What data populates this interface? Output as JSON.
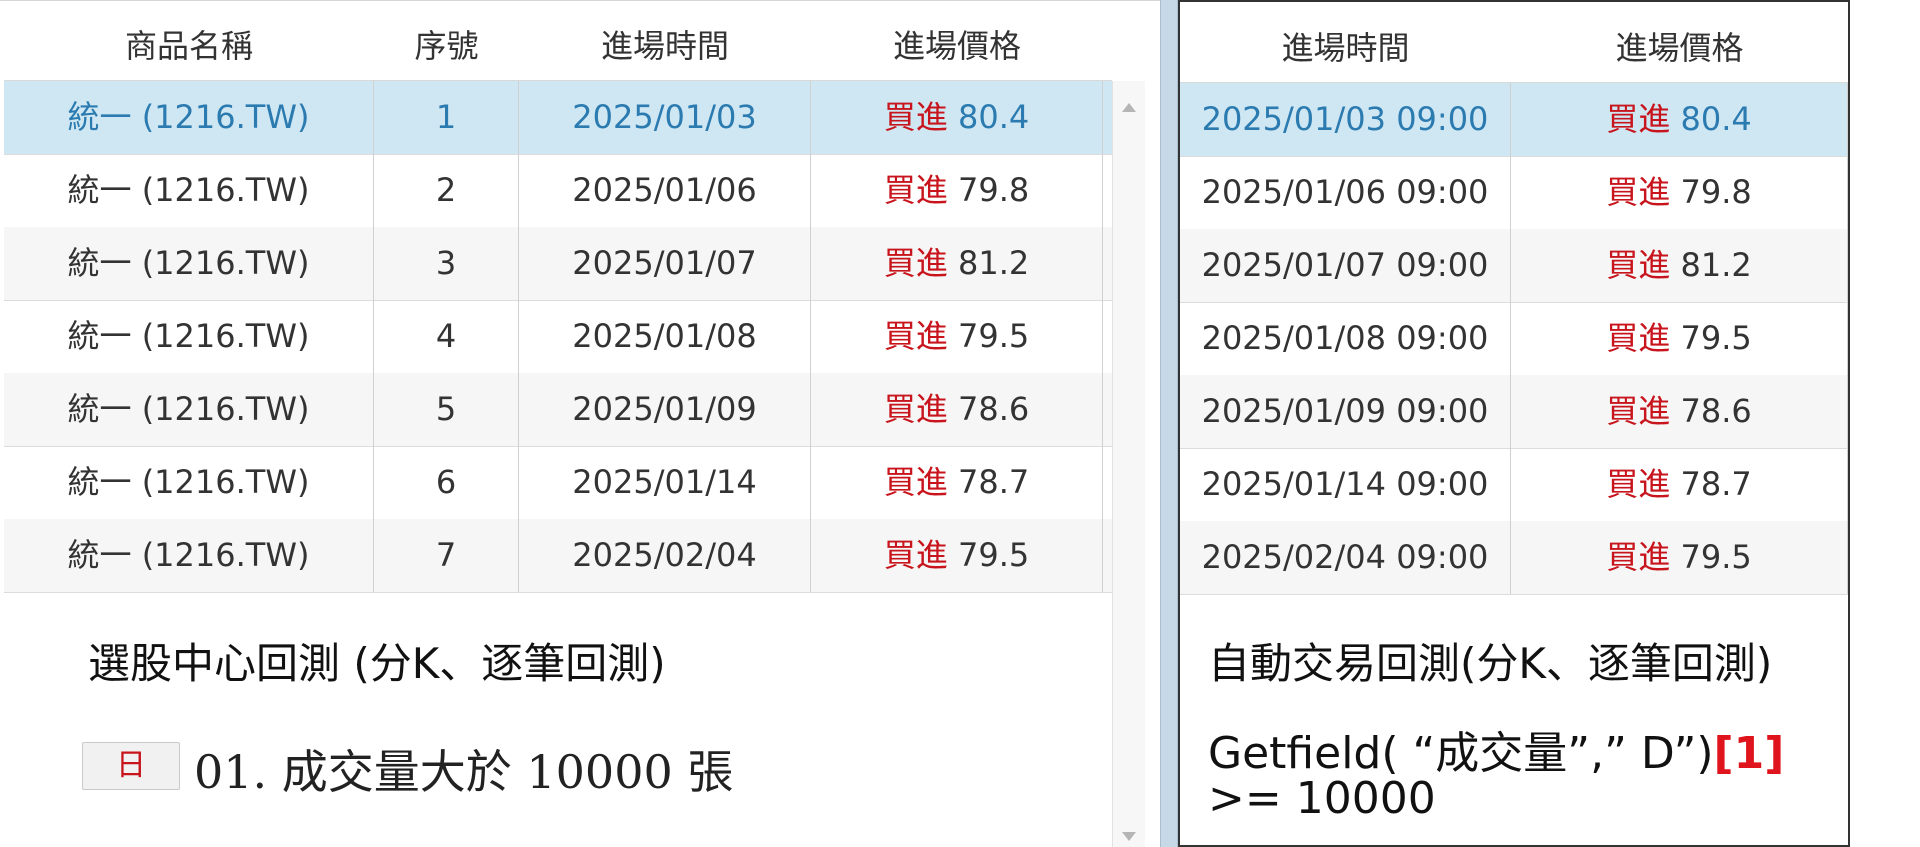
{
  "left_table": {
    "headers": [
      "商品名稱",
      "序號",
      "進場時間",
      "進場價格"
    ],
    "buy_label": "買進",
    "rows": [
      {
        "product": "統一 (1216.TW)",
        "seq": "1",
        "date": "2025/01/03",
        "price": "80.4"
      },
      {
        "product": "統一 (1216.TW)",
        "seq": "2",
        "date": "2025/01/06",
        "price": "79.8"
      },
      {
        "product": "統一 (1216.TW)",
        "seq": "3",
        "date": "2025/01/07",
        "price": "81.2"
      },
      {
        "product": "統一 (1216.TW)",
        "seq": "4",
        "date": "2025/01/08",
        "price": "79.5"
      },
      {
        "product": "統一 (1216.TW)",
        "seq": "5",
        "date": "2025/01/09",
        "price": "78.6"
      },
      {
        "product": "統一 (1216.TW)",
        "seq": "6",
        "date": "2025/01/14",
        "price": "78.7"
      },
      {
        "product": "統一 (1216.TW)",
        "seq": "7",
        "date": "2025/02/04",
        "price": "79.5"
      }
    ],
    "selected_row": 0
  },
  "left_caption": "選股中心回測 (分K、逐筆回測)",
  "condition": {
    "period_badge": "日",
    "text": "01. 成交量大於 10000 張"
  },
  "right_table": {
    "headers": [
      "進場時間",
      "進場價格"
    ],
    "buy_label": "買進",
    "rows": [
      {
        "time": "2025/01/03 09:00",
        "price": "80.4"
      },
      {
        "time": "2025/01/06 09:00",
        "price": "79.8"
      },
      {
        "time": "2025/01/07 09:00",
        "price": "81.2"
      },
      {
        "time": "2025/01/08 09:00",
        "price": "79.5"
      },
      {
        "time": "2025/01/09 09:00",
        "price": "78.6"
      },
      {
        "time": "2025/01/14 09:00",
        "price": "78.7"
      },
      {
        "time": "2025/02/04 09:00",
        "price": "79.5"
      }
    ],
    "selected_row": 0
  },
  "right_caption": "自動交易回測(分K、逐筆回測)",
  "formula": {
    "line1": "Getfield( “成交量”,” D”)",
    "ref": "[1]",
    "line2": ">= 10000"
  },
  "colors": {
    "buy_red": "#c8141c",
    "selected_row_bg": "#cfe7f3",
    "selected_row_text": "#2b7bb0",
    "formula_ref_red": "#e0141c"
  }
}
